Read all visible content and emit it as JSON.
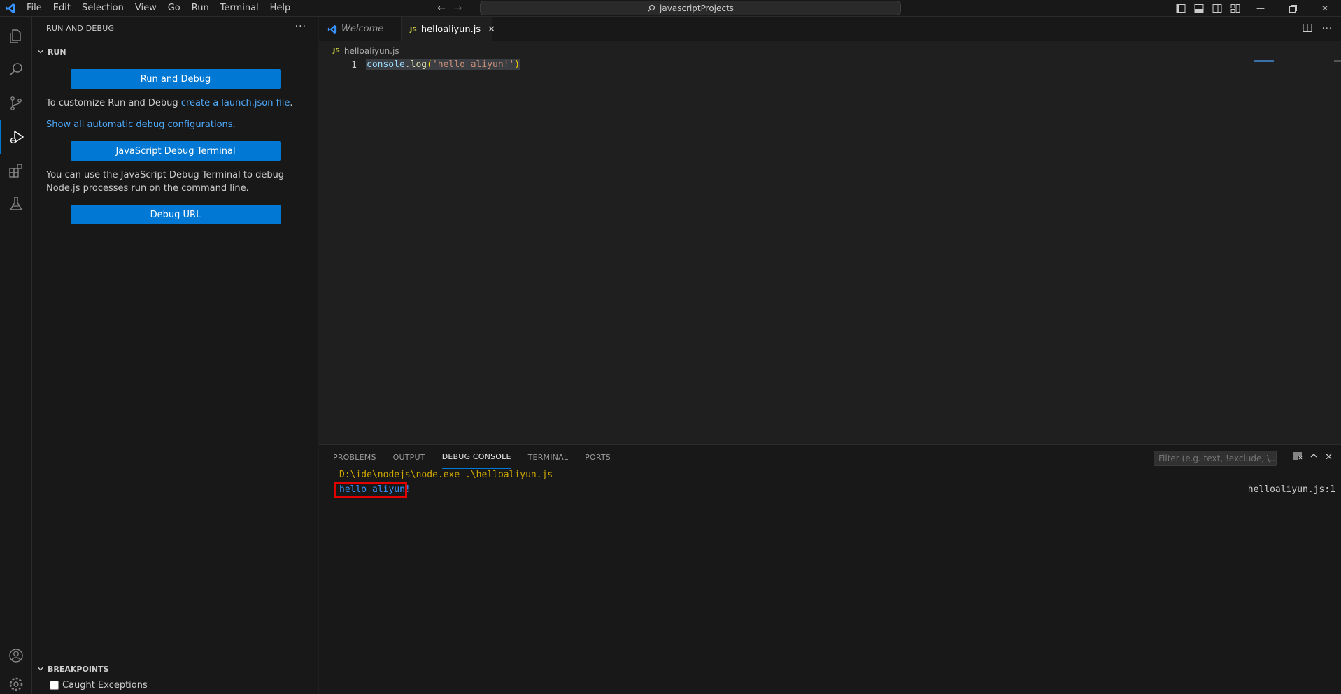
{
  "titlebar": {
    "menu": [
      "File",
      "Edit",
      "Selection",
      "View",
      "Go",
      "Run",
      "Terminal",
      "Help"
    ],
    "search_text": "javascriptProjects"
  },
  "sidebar": {
    "header": "RUN AND DEBUG",
    "run_section": "RUN",
    "run_debug_button": "Run and Debug",
    "customize_text": "To customize Run and Debug ",
    "customize_link": "create a launch.json file",
    "customize_suffix": ".",
    "show_configs_link": "Show all automatic debug configurations",
    "show_configs_suffix": ".",
    "js_debug_terminal_button": "JavaScript Debug Terminal",
    "js_debug_desc": "You can use the JavaScript Debug Terminal to debug Node.js processes run on the command line.",
    "debug_url_button": "Debug URL",
    "breakpoints_section": "BREAKPOINTS",
    "caught_exceptions": "Caught Exceptions"
  },
  "tabs": {
    "welcome": "Welcome",
    "file": "helloaliyun.js",
    "js_badge": "JS"
  },
  "editor": {
    "breadcrumb": "helloaliyun.js",
    "line_number": "1",
    "code": {
      "obj": "console",
      "dot": ".",
      "fn": "log",
      "open": "(",
      "str": "'hello aliyun!'",
      "close": ")"
    }
  },
  "panel": {
    "tabs": [
      "PROBLEMS",
      "OUTPUT",
      "DEBUG CONSOLE",
      "TERMINAL",
      "PORTS"
    ],
    "active_tab": "DEBUG CONSOLE",
    "filter_placeholder": "Filter (e.g. text, !exclude, \\...",
    "command_line": "D:\\ide\\nodejs\\node.exe .\\helloaliyun.js",
    "output_line": "hello aliyun!",
    "source_link": "helloaliyun.js:1"
  },
  "colors": {
    "accent": "#0078d4",
    "highlight_box": "#e50000",
    "output_text": "#3794ff",
    "command_text": "#cca700"
  }
}
